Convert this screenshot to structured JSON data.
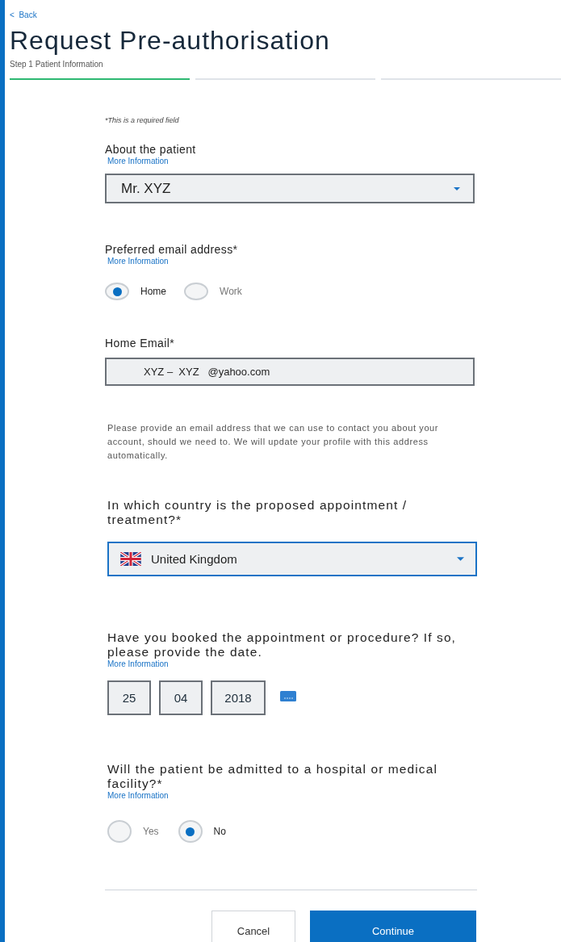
{
  "back_link": {
    "icon": "<",
    "label": "Back"
  },
  "title": "Request Pre-authorisation",
  "step": {
    "label": "Step 1 Patient Information",
    "segments": [
      {
        "selected": true
      },
      {
        "selected": false
      },
      {
        "selected": false
      }
    ]
  },
  "required_note": "*This is a required field",
  "patient": {
    "label": "About the patient",
    "more": "More Information",
    "value": "Mr. XYZ"
  },
  "preferred_email": {
    "label": "Preferred email address*",
    "more": "More Information",
    "options": [
      {
        "label": "Home",
        "selected": true
      },
      {
        "label": "Work",
        "selected": false
      }
    ]
  },
  "home_email": {
    "label": "Home Email*",
    "value": "XYZ –  XYZ   @yahoo.com"
  },
  "email_help": "Please provide an email address that we can use to contact you about your account, should we need to. We will update your profile with this address automatically.",
  "country": {
    "label": "In which country is the proposed appointment / treatment?*",
    "value": "United Kingdom"
  },
  "booked": {
    "label": "Have you booked the appointment or procedure? If so, please provide the date.",
    "more": "More Information",
    "day": "25",
    "month": "04",
    "year": "2018"
  },
  "admitted": {
    "label": "Will the patient be admitted to a hospital or medical facility?*",
    "more": "More Information",
    "options": [
      {
        "label": "Yes",
        "selected": false
      },
      {
        "label": "No",
        "selected": true
      }
    ]
  },
  "buttons": {
    "cancel": "Cancel",
    "continue": "Continue"
  }
}
